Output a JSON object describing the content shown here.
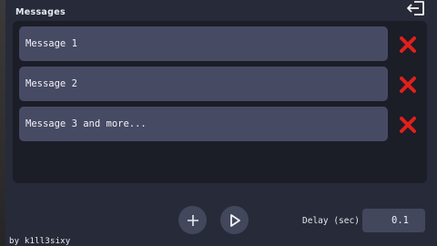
{
  "header": {
    "title": "Messages",
    "exit_icon": "exit-icon"
  },
  "messages": [
    {
      "text": "Message 1"
    },
    {
      "text": "Message 2"
    },
    {
      "text": "Message 3 and more..."
    }
  ],
  "delete_icon": "red-x-icon",
  "colors": {
    "delete": "#e0201b",
    "panel": "#272a38",
    "list": "#1b1d27",
    "row": "#474a63",
    "button": "#43475c"
  },
  "controls": {
    "add_icon": "plus-icon",
    "play_icon": "play-icon",
    "delay_label": "Delay (sec)",
    "delay_value": "0.1"
  },
  "footer": {
    "credit": "by k1ll3sixy"
  }
}
